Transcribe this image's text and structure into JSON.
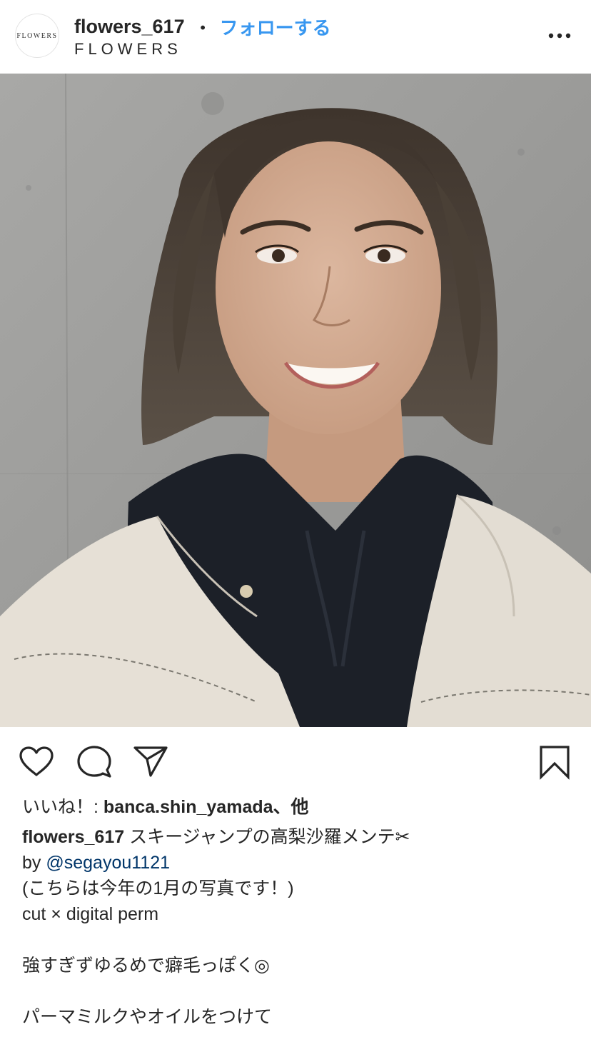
{
  "header": {
    "avatar_text": "FLOWERS",
    "username": "flowers_617",
    "separator": "・",
    "follow_label": "フォローする",
    "subtitle": "FLOWERS",
    "more_icon": "more-horizontal-icon"
  },
  "post": {
    "image_icon": "photo",
    "actions": {
      "like_icon": "heart-icon",
      "comment_icon": "comment-icon",
      "share_icon": "send-icon",
      "save_icon": "bookmark-icon"
    },
    "likes": {
      "prefix": "いいね！: ",
      "user": "banca.shin_yamada",
      "suffix": "、他"
    },
    "caption": {
      "username": "flowers_617",
      "first_text": " スキージャンプの高梨沙羅メンテ✂︎",
      "by_text": "by ",
      "mention": "@segayou1121",
      "line3": "(こちらは今年の1月の写真です！)",
      "line4": "cut × digital perm",
      "line6": "強すぎずゆるめで癖毛っぽく◎",
      "line8": "パーマミルクやオイルをつけて"
    }
  },
  "colors": {
    "link": "#3897f0",
    "mention": "#003569",
    "text": "#262626"
  }
}
